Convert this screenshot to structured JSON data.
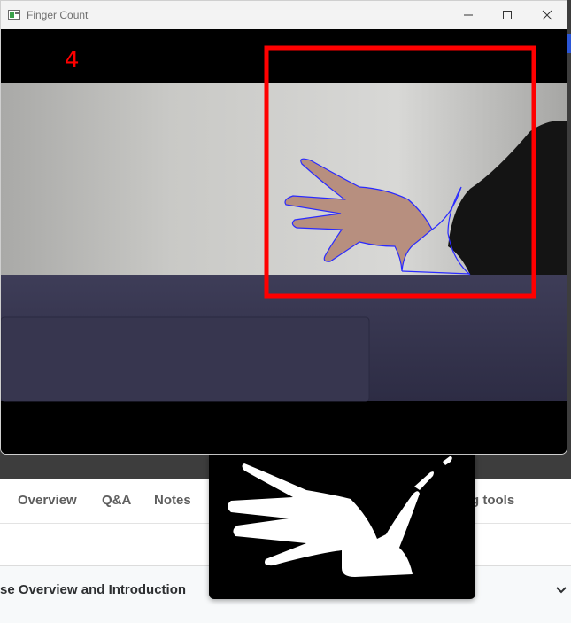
{
  "window": {
    "title": "Finger Count",
    "app_icon": "opencv-window-icon"
  },
  "controls": {
    "minimize": "minimize-icon",
    "maximize": "maximize-icon",
    "close": "close-icon"
  },
  "overlay": {
    "finger_count": "4",
    "count_color": "#ff0000",
    "roi_color": "#ff0000",
    "contour_color": "#2a2aff"
  },
  "course_page": {
    "tabs": [
      "Overview",
      "Q&A",
      "Notes",
      "g tools"
    ],
    "section_title": "se Overview and Introduction"
  },
  "mask_window": {
    "icon": "hand-mask-image"
  }
}
